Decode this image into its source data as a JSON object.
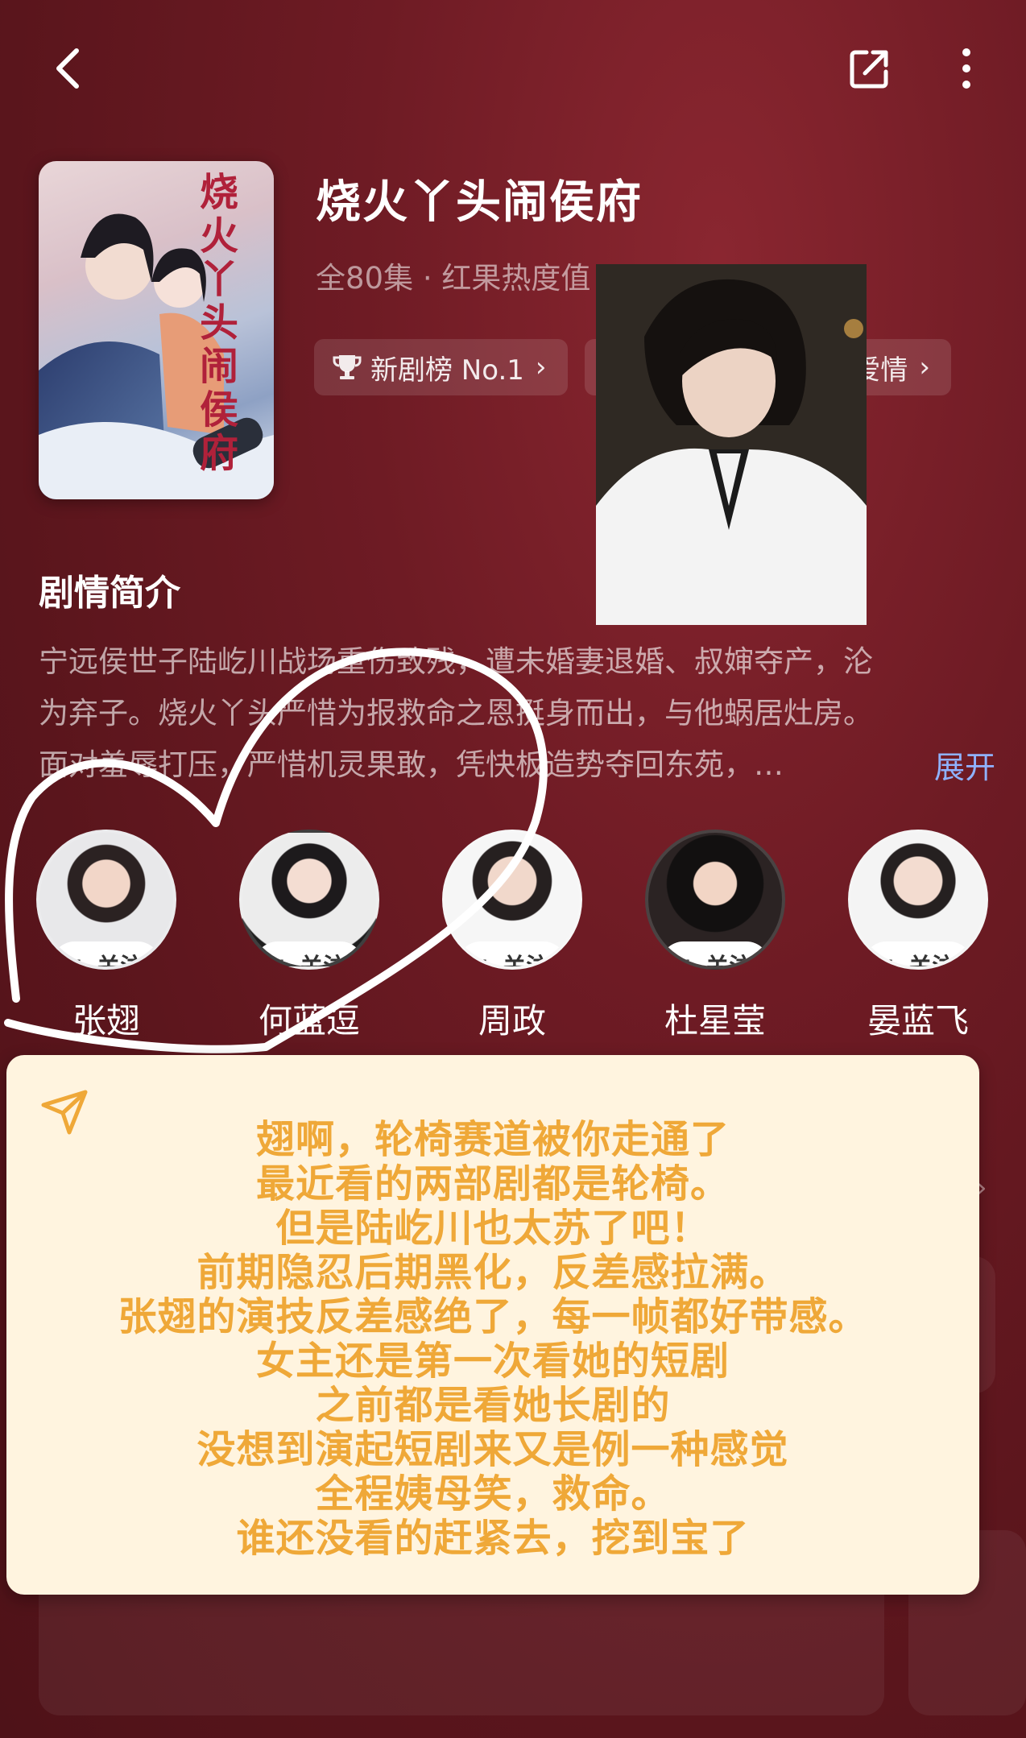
{
  "header": {
    "back_icon": "chevron-left-icon",
    "share_icon": "share-icon",
    "more_icon": "more-vertical-icon"
  },
  "drama": {
    "title": "烧火丫头闹侯府",
    "meta": "全80集 · 红果热度值",
    "cover_title": "烧火丫头闹侯府",
    "chips": [
      {
        "icon": "trophy-icon",
        "label": "新剧榜 No.1"
      },
      {
        "label": "爱情"
      }
    ]
  },
  "synopsis": {
    "heading": "剧情简介",
    "lines": [
      "宁远侯世子陆屹川战场重伤致残，遭未婚妻退婚、叔婶夺产，沦",
      "为弃子。烧火丫头严惜为报救命之恩挺身而出，与他蜗居灶房。",
      "面对羞辱打压，严惜机灵果敢，凭快板造势夺回东苑，…"
    ],
    "expand_label": "展开"
  },
  "cast": [
    {
      "name": "张翅",
      "follow": "+ 关注"
    },
    {
      "name": "何蓝逗",
      "follow": "+ 关注"
    },
    {
      "name": "周政",
      "follow": "+ 关注"
    },
    {
      "name": "杜星莹",
      "follow": "+ 关注"
    },
    {
      "name": "晏蓝飞",
      "follow": "+ 关注"
    }
  ],
  "note": {
    "icon": "send-icon",
    "lines": [
      "翅啊，轮椅赛道被你走通了",
      "最近看的两部剧都是轮椅。",
      "但是陆屹川也太苏了吧！",
      "前期隐忍后期黑化，反差感拉满。",
      "张翅的演技反差感绝了，每一帧都好带感。",
      "女主还是第一次看她的短剧",
      "之前都是看她长剧的",
      "没想到演起短剧来又是例一种感觉",
      "全程姨母笑，救命。",
      "谁还没看的赶紧去，挖到宝了"
    ]
  },
  "colors": {
    "background": "#6e1b24",
    "note_bg": "#fff4df",
    "note_text": "#efa838",
    "expand": "#8fb2ff"
  }
}
